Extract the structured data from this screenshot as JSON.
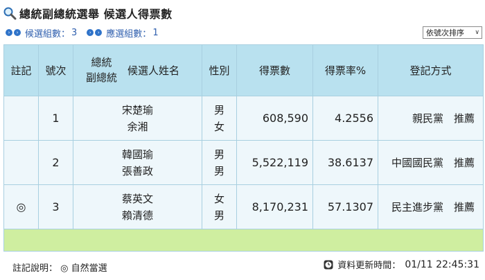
{
  "header": {
    "title": "總統副總統選舉 候選人得票數",
    "icon": "magnifier-icon"
  },
  "info": {
    "candidates_label": "候選組數：",
    "candidates_count": "3",
    "elected_label": "應選組數：",
    "elected_count": "1"
  },
  "sort": {
    "selected": "依號次排序"
  },
  "table": {
    "headers": {
      "mark": "註記",
      "number": "號次",
      "position_line1": "總統",
      "position_line2": "副總統",
      "name": "候選人姓名",
      "gender": "性別",
      "votes": "得票數",
      "rate": "得票率%",
      "registration": "登記方式"
    },
    "rows": [
      {
        "mark": "",
        "number": "1",
        "president": "宋楚瑜",
        "vice": "余湘",
        "gender_p": "男",
        "gender_v": "女",
        "votes": "608,590",
        "rate": "4.2556",
        "registration": "親民黨　推薦"
      },
      {
        "mark": "",
        "number": "2",
        "president": "韓國瑜",
        "vice": "張善政",
        "gender_p": "男",
        "gender_v": "男",
        "votes": "5,522,119",
        "rate": "38.6137",
        "registration": "中國國民黨　推薦"
      },
      {
        "mark": "◎",
        "number": "3",
        "president": "蔡英文",
        "vice": "賴清德",
        "gender_p": "女",
        "gender_v": "男",
        "votes": "8,170,231",
        "rate": "57.1307",
        "registration": "民主進步黨　推薦"
      }
    ]
  },
  "footer": {
    "legend": "註記說明： ◎ 自然當選",
    "update_label": "資料更新時間：",
    "update_time": "01/11 22:45:31"
  },
  "colors": {
    "header_bg": "#b9e1ef",
    "row_bg": "#eef7fb",
    "footer_row_bg": "#cfeea0",
    "border": "#a8cfe0",
    "link_blue": "#2f5fae"
  }
}
